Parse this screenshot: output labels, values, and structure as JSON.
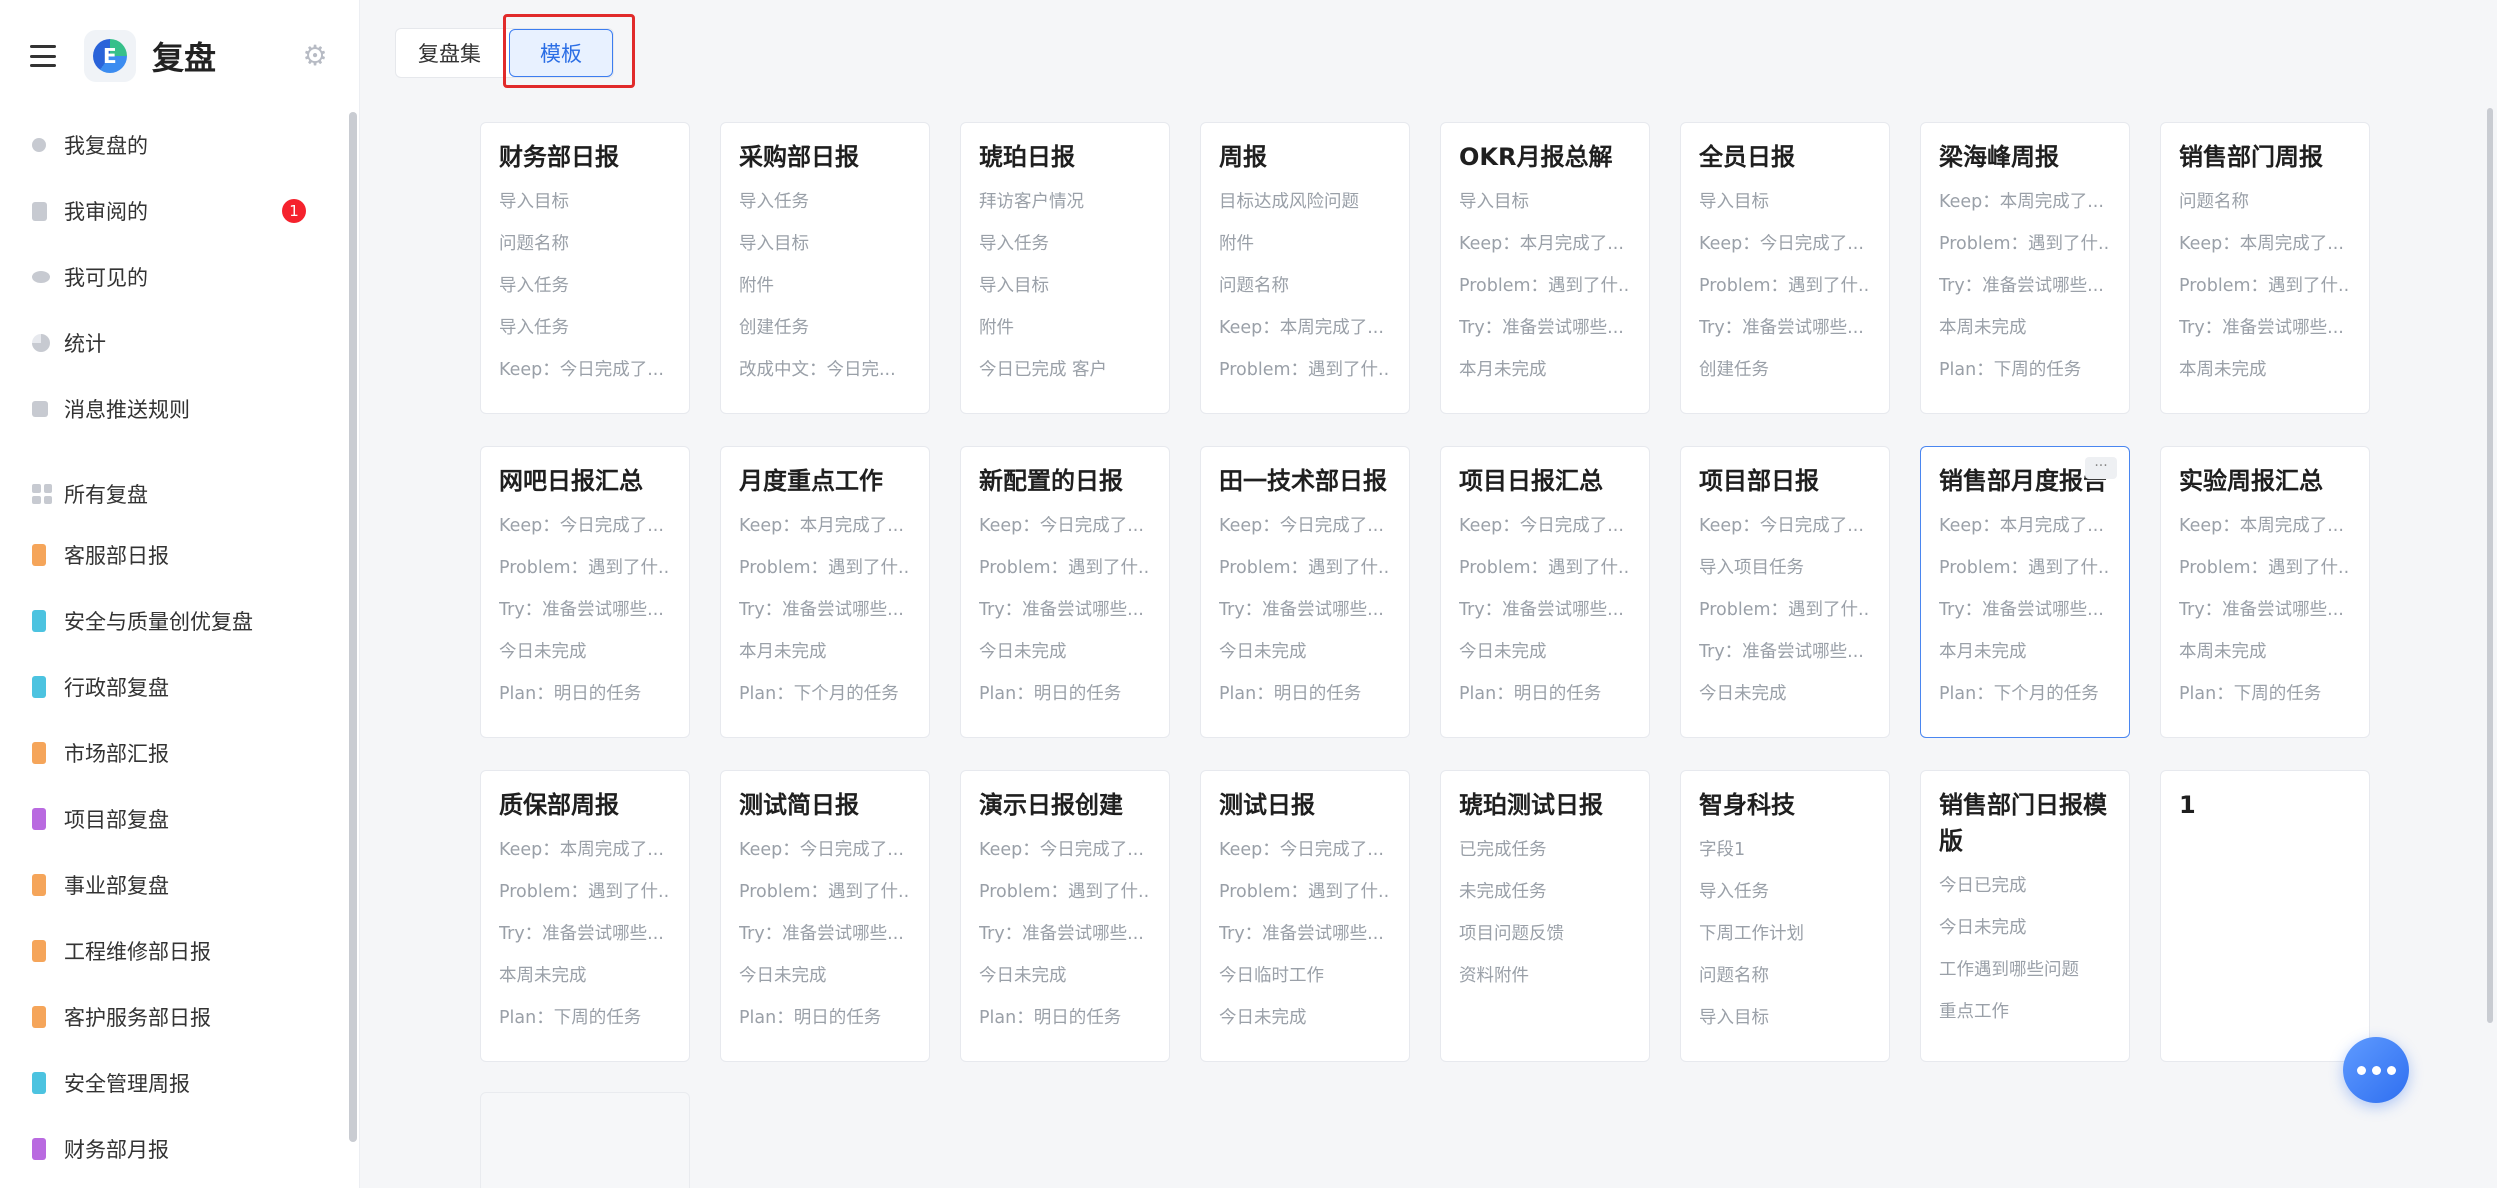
{
  "app": {
    "title": "复盘"
  },
  "sidebar": {
    "top_items": [
      {
        "label": "我复盘的",
        "icon": "user-icon"
      },
      {
        "label": "我审阅的",
        "icon": "clipboard-icon",
        "badge": "1"
      },
      {
        "label": "我可见的",
        "icon": "eye-icon"
      },
      {
        "label": "统计",
        "icon": "pie-chart-icon"
      },
      {
        "label": "消息推送规则",
        "icon": "edit-icon"
      }
    ],
    "all_label": "所有复盘",
    "groups": [
      {
        "label": "客服部日报",
        "color": "#f5a55a"
      },
      {
        "label": "安全与质量创优复盘",
        "color": "#4cc3e0"
      },
      {
        "label": "行政部复盘",
        "color": "#4cc3e0"
      },
      {
        "label": "市场部汇报",
        "color": "#f5a55a"
      },
      {
        "label": "项目部复盘",
        "color": "#b96ae0"
      },
      {
        "label": "事业部复盘",
        "color": "#f5a55a"
      },
      {
        "label": "工程维修部日报",
        "color": "#f5a55a"
      },
      {
        "label": "客护服务部日报",
        "color": "#f5a55a"
      },
      {
        "label": "安全管理周报",
        "color": "#4cc3e0"
      },
      {
        "label": "财务部月报",
        "color": "#b96ae0"
      }
    ]
  },
  "tabs": {
    "collection": "复盘集",
    "template": "模板"
  },
  "cards": [
    {
      "title": "财务部日报",
      "lines": [
        "导入目标",
        "问题名称",
        "导入任务",
        "导入任务",
        "Keep：今日完成了..."
      ]
    },
    {
      "title": "采购部日报",
      "lines": [
        "导入任务",
        "导入目标",
        "附件",
        "创建任务",
        "改成中文：今日完..."
      ]
    },
    {
      "title": "琥珀日报",
      "lines": [
        "拜访客户情况",
        "导入任务",
        "导入目标",
        "附件",
        "今日已完成 客户"
      ]
    },
    {
      "title": "周报",
      "lines": [
        "目标达成风险问题",
        "附件",
        "问题名称",
        "Keep：本周完成了...",
        "Problem：遇到了什..."
      ]
    },
    {
      "title": "OKR月报总解",
      "lines": [
        "导入目标",
        "Keep：本月完成了...",
        "Problem：遇到了什...",
        "Try：准备尝试哪些...",
        "本月未完成"
      ]
    },
    {
      "title": "全员日报",
      "lines": [
        "导入目标",
        "Keep：今日完成了...",
        "Problem：遇到了什...",
        "Try：准备尝试哪些...",
        "创建任务"
      ]
    },
    {
      "title": "梁海峰周报",
      "lines": [
        "Keep：本周完成了...",
        "Problem：遇到了什...",
        "Try：准备尝试哪些...",
        "本周未完成",
        "Plan：下周的任务"
      ]
    },
    {
      "title": "销售部门周报",
      "lines": [
        "问题名称",
        "Keep：本周完成了...",
        "Problem：遇到了什...",
        "Try：准备尝试哪些...",
        "本周未完成"
      ]
    },
    {
      "title": "网吧日报汇总",
      "lines": [
        "Keep：今日完成了...",
        "Problem：遇到了什...",
        "Try：准备尝试哪些...",
        "今日未完成",
        "Plan：明日的任务"
      ]
    },
    {
      "title": "月度重点工作",
      "lines": [
        "Keep：本月完成了...",
        "Problem：遇到了什...",
        "Try：准备尝试哪些...",
        "本月未完成",
        "Plan：下个月的任务"
      ]
    },
    {
      "title": "新配置的日报",
      "lines": [
        "Keep：今日完成了...",
        "Problem：遇到了什...",
        "Try：准备尝试哪些...",
        "今日未完成",
        "Plan：明日的任务"
      ]
    },
    {
      "title": "田一技术部日报",
      "lines": [
        "Keep：今日完成了...",
        "Problem：遇到了什...",
        "Try：准备尝试哪些...",
        "今日未完成",
        "Plan：明日的任务"
      ]
    },
    {
      "title": "项目日报汇总",
      "lines": [
        "Keep：今日完成了...",
        "Problem：遇到了什...",
        "Try：准备尝试哪些...",
        "今日未完成",
        "Plan：明日的任务"
      ]
    },
    {
      "title": "项目部日报",
      "lines": [
        "Keep：今日完成了...",
        "导入项目任务",
        "Problem：遇到了什...",
        "Try：准备尝试哪些...",
        "今日未完成"
      ]
    },
    {
      "title": "销售部月度报告",
      "lines": [
        "Keep：本月完成了...",
        "Problem：遇到了什...",
        "Try：准备尝试哪些...",
        "本月未完成",
        "Plan：下个月的任务"
      ],
      "selected": true,
      "more": "···"
    },
    {
      "title": "实验周报汇总",
      "lines": [
        "Keep：本周完成了...",
        "Problem：遇到了什...",
        "Try：准备尝试哪些...",
        "本周未完成",
        "Plan：下周的任务"
      ]
    },
    {
      "title": "质保部周报",
      "lines": [
        "Keep：本周完成了...",
        "Problem：遇到了什...",
        "Try：准备尝试哪些...",
        "本周未完成",
        "Plan：下周的任务"
      ]
    },
    {
      "title": "测试简日报",
      "lines": [
        "Keep：今日完成了...",
        "Problem：遇到了什...",
        "Try：准备尝试哪些...",
        "今日未完成",
        "Plan：明日的任务"
      ]
    },
    {
      "title": "演示日报创建",
      "lines": [
        "Keep：今日完成了...",
        "Problem：遇到了什...",
        "Try：准备尝试哪些...",
        "今日未完成",
        "Plan：明日的任务"
      ]
    },
    {
      "title": "测试日报",
      "lines": [
        "Keep：今日完成了...",
        "Problem：遇到了什...",
        "Try：准备尝试哪些...",
        "今日临时工作",
        "今日未完成"
      ]
    },
    {
      "title": "琥珀测试日报",
      "lines": [
        "已完成任务",
        "未完成任务",
        "项目问题反馈",
        "资料附件"
      ]
    },
    {
      "title": "智身科技",
      "lines": [
        "字段1",
        "导入任务",
        "下周工作计划",
        "问题名称",
        "导入目标"
      ]
    },
    {
      "title": "销售部门日报模版",
      "lines": [
        "今日已完成",
        "今日未完成",
        "工作遇到哪些问题",
        "重点工作"
      ],
      "wrap": true
    },
    {
      "title": "1",
      "lines": []
    }
  ]
}
